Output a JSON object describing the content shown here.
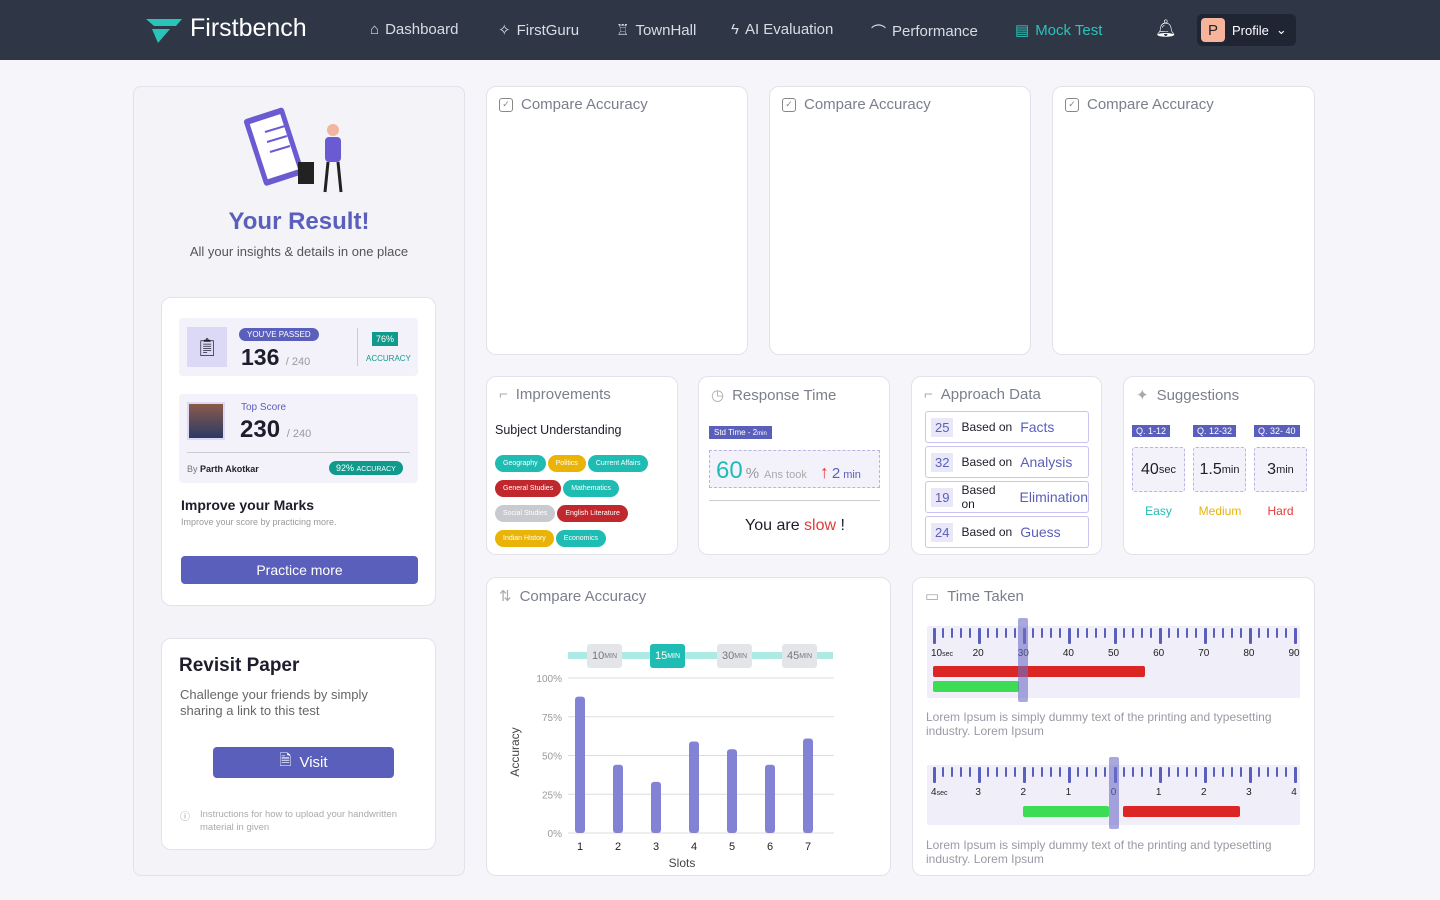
{
  "nav": {
    "brand": "Firstbench",
    "items": [
      {
        "label": "Dashboard",
        "icon": "home-icon"
      },
      {
        "label": "FirstGuru",
        "icon": "sparkle-icon"
      },
      {
        "label": "TownHall",
        "icon": "tower-icon"
      },
      {
        "label": "AI Evaluation",
        "icon": "bolt-icon"
      },
      {
        "label": "Performance",
        "icon": "chart-icon"
      },
      {
        "label": "Mock Test",
        "icon": "document-icon",
        "active": true
      }
    ],
    "profile_initial": "P",
    "profile_label": "Profile"
  },
  "result": {
    "title": "Your Result!",
    "subtitle": "All your insights & details in one place",
    "passed_badge": "YOU'VE PASSED",
    "score": "136",
    "total": "/ 240",
    "accuracy": "76%",
    "accuracy_label": "ACCURACY",
    "top_label": "Top Score",
    "top_score": "230",
    "top_total": "/ 240",
    "by": "By",
    "top_name": "Parth Akotkar",
    "top_accuracy": "92%",
    "top_accuracy_label": "ACCURACY",
    "improve_title": "Improve your Marks",
    "improve_sub": "Improve your score by practicing more.",
    "practice_btn": "Practice more"
  },
  "revisit": {
    "title": "Revisit Paper",
    "text": "Challenge your friends by simply sharing a link to this test",
    "visit_btn": "Visit",
    "note": "Instructions for how to upload your handwritten material in given"
  },
  "compare_cards": [
    "Compare Accuracy",
    "Compare Accuracy",
    "Compare Accuracy"
  ],
  "improvements": {
    "title": "Improvements",
    "heading": "Subject Understanding",
    "chips": [
      {
        "label": "Geography",
        "color": "#1fbcb3"
      },
      {
        "label": "Politics",
        "color": "#eab308"
      },
      {
        "label": "Current Affairs",
        "color": "#1fbcb3"
      },
      {
        "label": "General Studies",
        "color": "#c0282d"
      },
      {
        "label": "Mathematics",
        "color": "#1fbcb3"
      },
      {
        "label": "Social Studies",
        "color": "#c8cad0"
      },
      {
        "label": "English Literature",
        "color": "#c0282d"
      },
      {
        "label": "Indian History",
        "color": "#eab308"
      },
      {
        "label": "Economics",
        "color": "#1fbcb3"
      }
    ]
  },
  "response": {
    "title": "Response Time",
    "std": "Std Time - 2",
    "std_unit": "min",
    "pct": "60",
    "pct_sym": "%",
    "ans_took": "Ans took",
    "time": "2",
    "time_unit": "min",
    "verdict_pre": "You are ",
    "verdict": "slow",
    "verdict_post": " !"
  },
  "approach": {
    "title": "Approach Data",
    "prefix": "Based on",
    "items": [
      {
        "pct": "25",
        "label": "Facts"
      },
      {
        "pct": "32",
        "label": "Analysis"
      },
      {
        "pct": "19",
        "label": "Elimination"
      },
      {
        "pct": "24",
        "label": "Guess"
      }
    ]
  },
  "suggestions": {
    "title": "Suggestions",
    "items": [
      {
        "range": "Q. 1-12",
        "value": "40",
        "unit": "sec",
        "level": "Easy",
        "color": "#1fbcb3"
      },
      {
        "range": "Q. 12-32",
        "value": "1.5",
        "unit": "min",
        "level": "Medium",
        "color": "#eab308"
      },
      {
        "range": "Q. 32- 40",
        "value": "3",
        "unit": "min",
        "level": "Hard",
        "color": "#e23a3a"
      }
    ]
  },
  "chart_card": {
    "title": "Compare Accuracy",
    "slots": [
      {
        "v": "10",
        "u": "MIN"
      },
      {
        "v": "15",
        "u": "MIN",
        "active": true
      },
      {
        "v": "30",
        "u": "MIN"
      },
      {
        "v": "45",
        "u": "MIN"
      }
    ]
  },
  "chart_data": {
    "type": "bar",
    "categories": [
      "1",
      "2",
      "3",
      "4",
      "5",
      "6",
      "7"
    ],
    "values": [
      88,
      44,
      33,
      59,
      54,
      44,
      61
    ],
    "xlabel": "Slots",
    "ylabel": "Accuracy",
    "ylim": [
      0,
      100
    ],
    "yticks": [
      "0%",
      "25%",
      "50%",
      "75%",
      "100%"
    ],
    "color": "#8383d6"
  },
  "time_taken": {
    "title": "Time Taken",
    "ruler1": {
      "labels": [
        "10",
        "20",
        "30",
        "40",
        "50",
        "60",
        "70",
        "80",
        "90"
      ],
      "first_unit": "sec",
      "marker": 30,
      "red_end": 57,
      "green_end": 29
    },
    "ruler2": {
      "labels": [
        "4",
        "3",
        "2",
        "1",
        "0",
        "1",
        "2",
        "3",
        "4"
      ],
      "first_unit": "sec",
      "marker": 0,
      "green": [
        -2,
        -0.1
      ],
      "red": [
        0.2,
        2.8
      ]
    },
    "text1": "Lorem Ipsum is simply dummy text of the printing and typesetting industry. Lorem Ipsum",
    "text2": "Lorem Ipsum is simply dummy text of the printing and typesetting industry. Lorem Ipsum"
  }
}
